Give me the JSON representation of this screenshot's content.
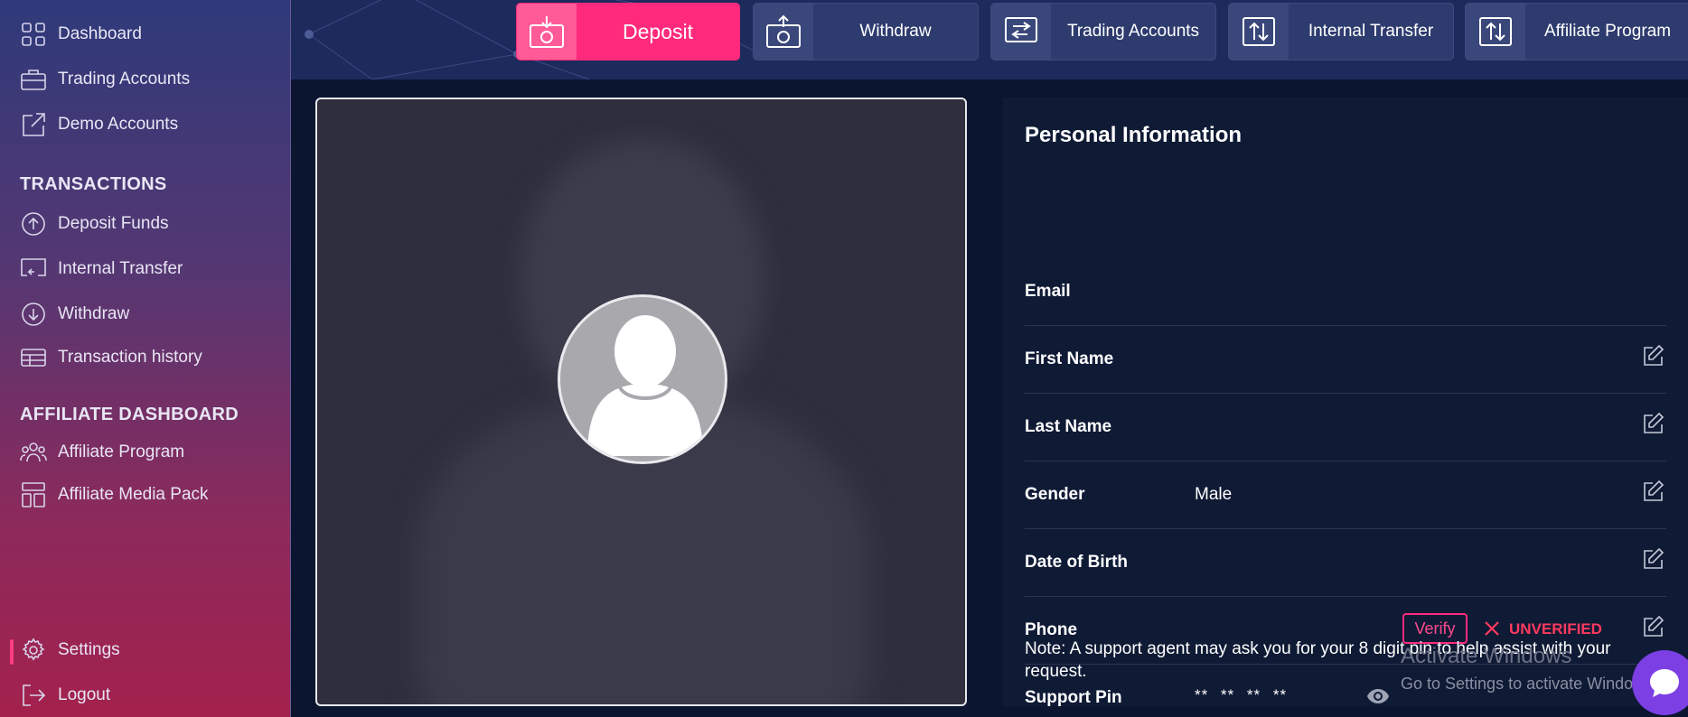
{
  "sidebar": {
    "items": [
      {
        "label": "Dashboard",
        "icon": "grid-icon"
      },
      {
        "label": "Trading Accounts",
        "icon": "briefcase-icon"
      },
      {
        "label": "Demo Accounts",
        "icon": "external-link-icon"
      }
    ],
    "sections": [
      {
        "title": "TRANSACTIONS",
        "items": [
          {
            "label": "Deposit Funds",
            "icon": "arrow-up-circle-icon"
          },
          {
            "label": "Internal Transfer",
            "icon": "transfer-screen-icon"
          },
          {
            "label": "Withdraw",
            "icon": "arrow-down-circle-icon"
          },
          {
            "label": "Transaction history",
            "icon": "table-icon"
          }
        ]
      },
      {
        "title": "AFFILIATE DASHBOARD",
        "items": [
          {
            "label": "Affiliate Program",
            "icon": "users-icon"
          },
          {
            "label": "Affiliate Media Pack",
            "icon": "layout-icon"
          }
        ]
      }
    ],
    "bottom": [
      {
        "label": "Settings",
        "icon": "gear-icon",
        "active": true
      },
      {
        "label": "Logout",
        "icon": "logout-icon"
      }
    ]
  },
  "topbar": {
    "buttons": [
      {
        "label": "Deposit",
        "icon": "deposit-icon"
      },
      {
        "label": "Withdraw",
        "icon": "withdraw-icon"
      },
      {
        "label": "Trading Accounts",
        "icon": "trading-accounts-icon"
      },
      {
        "label": "Internal Transfer",
        "icon": "internal-transfer-icon"
      },
      {
        "label": "Affiliate Program",
        "icon": "affiliate-program-icon"
      }
    ]
  },
  "profile": {
    "title": "Personal Information",
    "fields": {
      "email": {
        "label": "Email",
        "value": ""
      },
      "first_name": {
        "label": "First Name",
        "value": ""
      },
      "last_name": {
        "label": "Last Name",
        "value": ""
      },
      "gender": {
        "label": "Gender",
        "value": "Male"
      },
      "dob": {
        "label": "Date of Birth",
        "value": ""
      },
      "phone": {
        "label": "Phone",
        "verify_label": "Verify",
        "status": "UNVERIFIED"
      },
      "support_pin": {
        "label": "Support Pin",
        "value": "** ** ** **"
      }
    },
    "note": "Note: A support agent may ask you for your 8 digit pin to help assist with your request."
  },
  "watermark": {
    "title": "Activate Windows",
    "subtitle": "Go to Settings to activate Windows."
  },
  "colors": {
    "accent": "#ff2a7c",
    "unverified": "#ff3a5f",
    "panel": "#0f1a35"
  }
}
